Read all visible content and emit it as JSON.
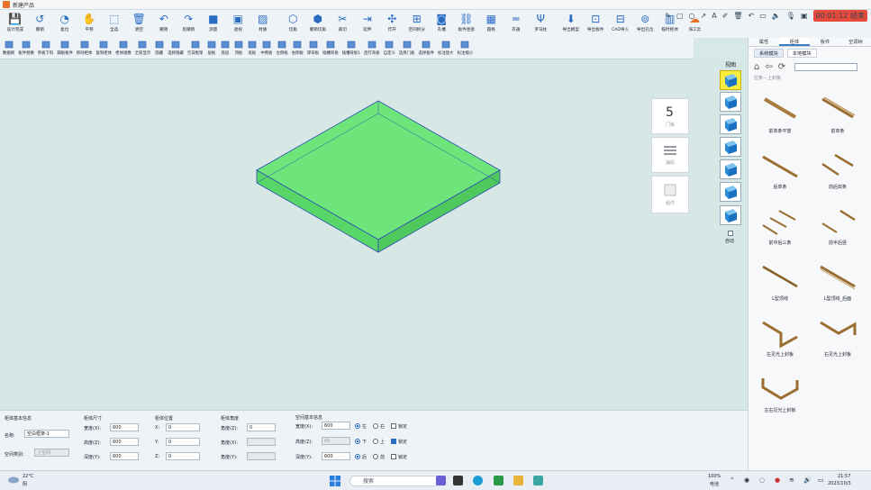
{
  "window": {
    "title": "新建产品"
  },
  "ribbon1": [
    {
      "label": "设计完成",
      "icon": "save-icon",
      "color": "#2a6cc4"
    },
    {
      "label": "撤销",
      "icon": "undo-circle-icon",
      "color": "#2a6cc4"
    },
    {
      "label": "复位",
      "icon": "reset-icon",
      "color": "#2a6cc4"
    },
    {
      "label": "平移",
      "icon": "hand-icon",
      "color": "#445"
    },
    {
      "label": "全选",
      "icon": "select-all-icon",
      "color": "#2a6cc4"
    },
    {
      "label": "清空",
      "icon": "trash-icon",
      "color": "#2a6cc4"
    },
    {
      "label": "撤销",
      "icon": "undo-icon",
      "color": "#2a6cc4"
    },
    {
      "label": "反撤销",
      "icon": "redo-icon",
      "color": "#2a6cc4"
    },
    {
      "label": "测量",
      "icon": "measure-icon",
      "color": "#2a6cc4"
    },
    {
      "label": "透视",
      "icon": "perspective-icon",
      "color": "#2a6cc4"
    },
    {
      "label": "材质",
      "icon": "material-icon",
      "color": "#2a6cc4"
    },
    {
      "label": "切角",
      "icon": "chamfer-icon",
      "color": "#2a6cc4"
    },
    {
      "label": "撤销切角",
      "icon": "undo-chamfer-icon",
      "color": "#2a6cc4"
    },
    {
      "label": "裁切",
      "icon": "cut-icon",
      "color": "#2a6cc4"
    },
    {
      "label": "延伸",
      "icon": "extend-icon",
      "color": "#2a6cc4"
    },
    {
      "label": "炸开",
      "icon": "explode-icon",
      "color": "#2a6cc4"
    },
    {
      "label": "空间拆分",
      "icon": "split-icon",
      "color": "#2a6cc4"
    },
    {
      "label": "孔槽",
      "icon": "hole-icon",
      "color": "#2a6cc4"
    },
    {
      "label": "板件连接",
      "icon": "link-icon",
      "color": "#2a6cc4"
    },
    {
      "label": "圆格",
      "icon": "grid-icon",
      "color": "#2a6cc4"
    },
    {
      "label": "衣通",
      "icon": "rod-icon",
      "color": "#2a6cc4"
    },
    {
      "label": "罗马柱",
      "icon": "column-icon",
      "color": "#2a6cc4"
    },
    {
      "label": "导出模型",
      "icon": "export-model-icon",
      "color": "#2a6cc4"
    },
    {
      "label": "导出板件",
      "icon": "cad-export-icon",
      "color": "#2a6cc4"
    },
    {
      "label": "CAD导入",
      "icon": "cad-import-icon",
      "color": "#2a6cc4"
    },
    {
      "label": "导出孔位",
      "icon": "export-holes-icon",
      "color": "#2a6cc4"
    },
    {
      "label": "临时柜体",
      "icon": "temp-cabinet-icon",
      "color": "#2a6cc4"
    },
    {
      "label": "海工云",
      "icon": "cloud-icon",
      "color": "#e8722a"
    }
  ],
  "topright": {
    "record": "00:01:12 结束"
  },
  "ribbon2": [
    {
      "label": "数据刷"
    },
    {
      "label": "板件替换"
    },
    {
      "label": "单板下料"
    },
    {
      "label": "辅助板件"
    },
    {
      "label": "移除柜体"
    },
    {
      "label": "复制柜体"
    },
    {
      "label": "柜体镜像"
    },
    {
      "label": "全部显示"
    },
    {
      "label": "隐藏"
    },
    {
      "label": "选择隐藏"
    },
    {
      "label": "空白框架"
    },
    {
      "label": "层板"
    },
    {
      "label": "底层"
    },
    {
      "label": "顶板"
    },
    {
      "label": "底板"
    },
    {
      "label": "中侧板"
    },
    {
      "label": "左侧板"
    },
    {
      "label": "右侧板"
    },
    {
      "label": "厚背板"
    },
    {
      "label": "插槽背板"
    },
    {
      "label": "插槽背板1"
    },
    {
      "label": "后钉背板"
    },
    {
      "label": "自定义"
    },
    {
      "label": "选择门板"
    },
    {
      "label": "选择板件"
    },
    {
      "label": "标注放大"
    },
    {
      "label": "标注缩小"
    }
  ],
  "view": {
    "label": "视图",
    "auto": "自动"
  },
  "floatPanels": [
    {
      "label": "门板",
      "icon": "door-icon"
    },
    {
      "label": "抽屉",
      "icon": "drawer-icon"
    },
    {
      "label": "组件",
      "icon": "component-icon"
    }
  ],
  "rpanel": {
    "tabs": [
      "属性",
      "柜体",
      "板件",
      "空调树"
    ],
    "subtabs": [
      "系统模块",
      "本地模块"
    ],
    "path": "拉条—上封板",
    "items": [
      {
        "label": "前单条平放"
      },
      {
        "label": "前单条"
      },
      {
        "label": "后单条"
      },
      {
        "label": "前后双条"
      },
      {
        "label": "前中后三条"
      },
      {
        "label": "前半后竖"
      },
      {
        "label": "L型顶线"
      },
      {
        "label": "L型顶线_后面"
      },
      {
        "label": "左见光上封板"
      },
      {
        "label": "右见光上封板"
      },
      {
        "label": "左右见光上封板"
      }
    ]
  },
  "bottom": {
    "basic": {
      "title": "柜体基本信息",
      "name_label": "名称:",
      "name_value": "空白框架-1",
      "cat_label": "空间类别:",
      "cat_value": "上空间"
    },
    "size": {
      "title": "柜体尺寸",
      "w_label": "宽度(X):",
      "w": "600",
      "h_label": "高度(Z):",
      "h": "600",
      "d_label": "深度(Y):",
      "d": "600"
    },
    "pos": {
      "title": "柜体位置",
      "x_label": "X:",
      "x": "0",
      "y_label": "Y:",
      "y": "0",
      "z_label": "Z:",
      "z": "0"
    },
    "angle": {
      "title": "柜体角度",
      "a1_label": "角度(Z):",
      "a1": "0",
      "a2_label": "角度(X):",
      "a2": "",
      "a3_label": "角度(Y):",
      "a3": ""
    },
    "space": {
      "title": "空间基本信息",
      "w_label": "宽度(X):",
      "w": "600",
      "h_label": "高度(Z):",
      "h": "60",
      "d_label": "深度(Y):",
      "d": "600",
      "r1a": "左",
      "r1b": "右",
      "r2a": "下",
      "r2b": "上",
      "r3a": "后",
      "r3b": "前",
      "lock": "锁定"
    }
  },
  "taskbar": {
    "temp": "22°C",
    "weather": "阴",
    "search": "搜索",
    "battery": "100%",
    "battery_label": "电池",
    "time": "21:57",
    "date": "2023/10/3"
  }
}
